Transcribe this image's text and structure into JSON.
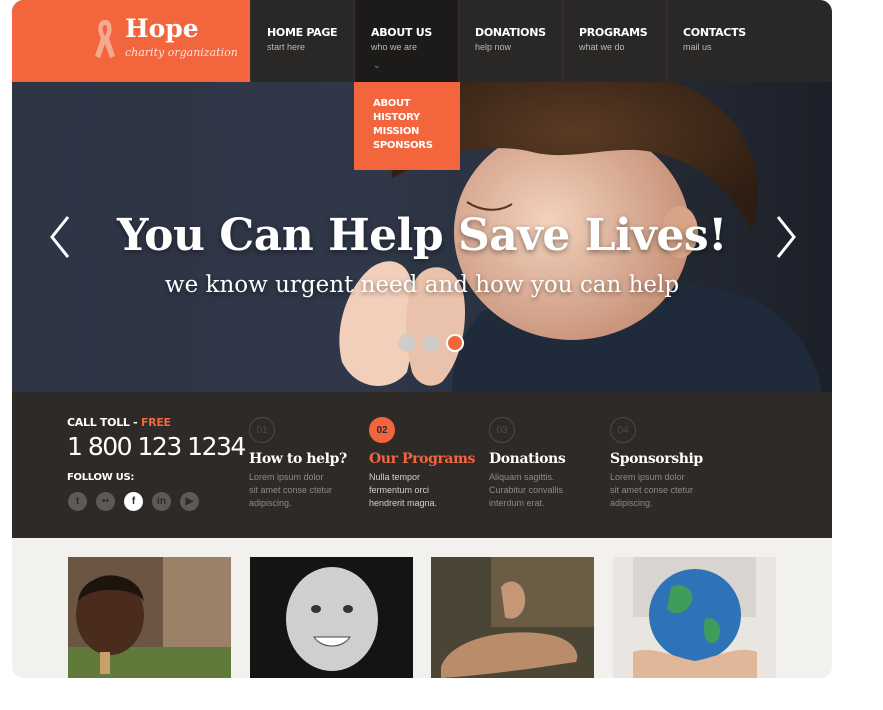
{
  "brand": {
    "name": "Hope",
    "tagline": "charity organization"
  },
  "nav": [
    {
      "label": "HOME PAGE",
      "sub": "start here"
    },
    {
      "label": "ABOUT US",
      "sub": "who we are",
      "active": true
    },
    {
      "label": "DONATIONS",
      "sub": "help now"
    },
    {
      "label": "PROGRAMS",
      "sub": "what we do"
    },
    {
      "label": "CONTACTS",
      "sub": "mail us"
    }
  ],
  "dropdown": [
    "ABOUT",
    "HISTORY",
    "MISSION",
    "SPONSORS"
  ],
  "hero": {
    "headline": "You Can Help Save Lives!",
    "subline": "we know urgent need and how you can help",
    "slides": 3,
    "active_slide": 3
  },
  "contact": {
    "call_label": "CALL TOLL - ",
    "call_free": "FREE",
    "phone": "1 800 123 1234",
    "follow_label": "FOLLOW US:",
    "socials": [
      "twitter-icon",
      "flickr-icon",
      "facebook-icon",
      "linkedin-icon",
      "youtube-icon"
    ]
  },
  "features": [
    {
      "num": "01",
      "title": "How to help?",
      "text": [
        "Lorem ipsum dolor",
        "sit amet conse ctetur",
        "adipiscing."
      ]
    },
    {
      "num": "02",
      "title": "Our Programs",
      "text": [
        "Nulla tempor",
        "fermentum orci",
        "hendrerit magna."
      ],
      "active": true
    },
    {
      "num": "03",
      "title": "Donations",
      "text": [
        "Aliquam sagittis.",
        "Curabitur convallis",
        "interdum erat."
      ]
    },
    {
      "num": "04",
      "title": "Sponsorship",
      "text": [
        "Lorem ipsum dolor",
        "sit amet conse ctetur",
        "adipiscing."
      ]
    }
  ],
  "colors": {
    "accent": "#f2653d",
    "dark": "#2a2827",
    "band": "#2e2a27"
  }
}
